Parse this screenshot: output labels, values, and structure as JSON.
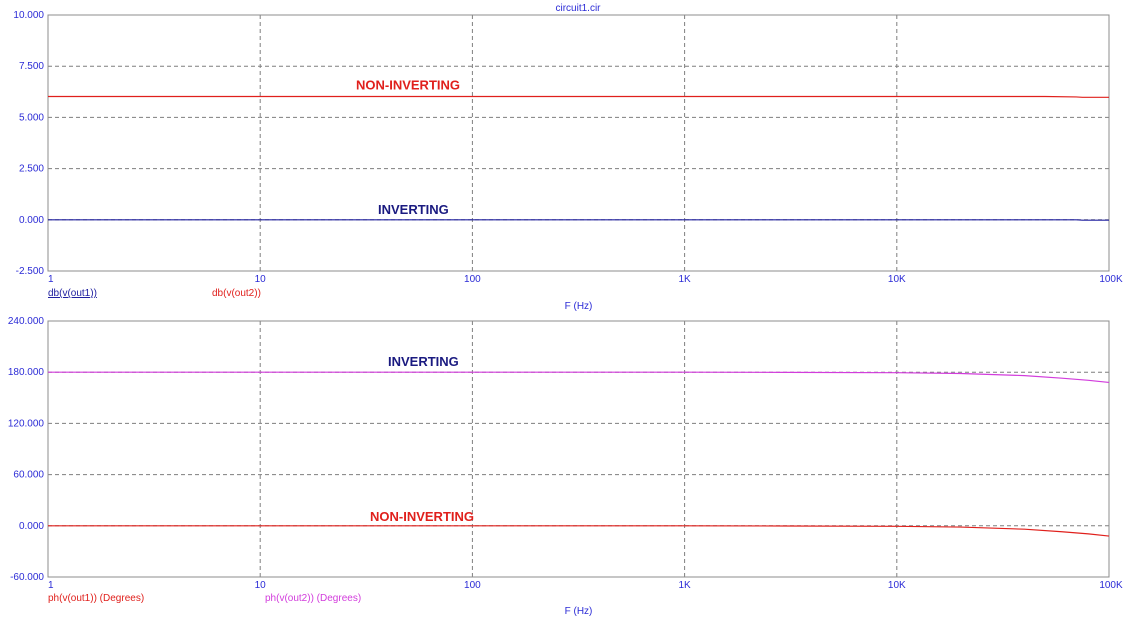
{
  "title": "circuit1.cir",
  "colors": {
    "axis_text": "#2b2bd6",
    "red": "#e0201c",
    "magenta": "#d23cdc",
    "navy": "#1a1a80"
  },
  "chart_data": [
    {
      "type": "line",
      "xscale": "log",
      "xlim": [
        1,
        100000
      ],
      "ylim": [
        -2.5,
        10
      ],
      "xlabel": "F (Hz)",
      "xticks": [
        1,
        10,
        100,
        1000,
        10000,
        100000
      ],
      "xtick_labels": [
        "1",
        "10",
        "100",
        "1K",
        "10K",
        "100K"
      ],
      "yticks": [
        -2.5,
        0,
        2.5,
        5,
        7.5,
        10
      ],
      "ytick_labels": [
        "-2.500",
        "0.000",
        "2.500",
        "5.000",
        "7.500",
        "10.000"
      ],
      "grid": true,
      "legend": [
        "db(v(out1))",
        "db(v(out2))"
      ],
      "series": [
        {
          "name": "db(v(out1))",
          "color": "#2020a0",
          "x": [
            1,
            10,
            100,
            1000,
            10000,
            50000,
            70000,
            75000,
            100000
          ],
          "y": [
            0.0,
            0.0,
            0.0,
            0.0,
            0.0,
            0.0,
            0.0,
            -0.02,
            -0.02
          ]
        },
        {
          "name": "db(v(out2))",
          "color": "#e0201c",
          "x": [
            1,
            10,
            100,
            1000,
            10000,
            50000,
            70000,
            75000,
            100000
          ],
          "y": [
            6.02,
            6.02,
            6.02,
            6.02,
            6.02,
            6.02,
            6.0,
            5.98,
            5.98
          ]
        }
      ],
      "annotations": [
        {
          "text": "NON-INVERTING",
          "x": 100,
          "y": 6.02,
          "color": "#e0201c"
        },
        {
          "text": "INVERTING",
          "x": 100,
          "y": 0.0,
          "color": "#1a1a80"
        }
      ]
    },
    {
      "type": "line",
      "xscale": "log",
      "xlim": [
        1,
        100000
      ],
      "ylim": [
        -60,
        240
      ],
      "xlabel": "F (Hz)",
      "xticks": [
        1,
        10,
        100,
        1000,
        10000,
        100000
      ],
      "xtick_labels": [
        "1",
        "10",
        "100",
        "1K",
        "10K",
        "100K"
      ],
      "yticks": [
        -60,
        0,
        60,
        120,
        180,
        240
      ],
      "ytick_labels": [
        "-60.000",
        "0.000",
        "60.000",
        "120.000",
        "180.000",
        "240.000"
      ],
      "grid": true,
      "legend": [
        "ph(v(out1)) (Degrees)",
        "ph(v(out2)) (Degrees)"
      ],
      "series": [
        {
          "name": "ph(v(out1)) (Degrees)",
          "color": "#e0201c",
          "x": [
            1,
            10,
            100,
            1000,
            3000,
            10000,
            20000,
            40000,
            60000,
            80000,
            100000
          ],
          "y": [
            0,
            0,
            0,
            0,
            -0.2,
            -0.6,
            -1.5,
            -4,
            -7,
            -9.5,
            -12
          ]
        },
        {
          "name": "ph(v(out2)) (Degrees)",
          "color": "#d23cdc",
          "x": [
            1,
            10,
            100,
            1000,
            3000,
            10000,
            20000,
            40000,
            60000,
            80000,
            100000
          ],
          "y": [
            180,
            180,
            180,
            180,
            179.8,
            179.4,
            178.5,
            176,
            173,
            170.5,
            168
          ]
        }
      ],
      "annotations": [
        {
          "text": "INVERTING",
          "x": 100,
          "y": 180,
          "color": "#1a1a80"
        },
        {
          "text": "NON-INVERTING",
          "x": 100,
          "y": 0,
          "color": "#e0201c"
        }
      ]
    }
  ]
}
